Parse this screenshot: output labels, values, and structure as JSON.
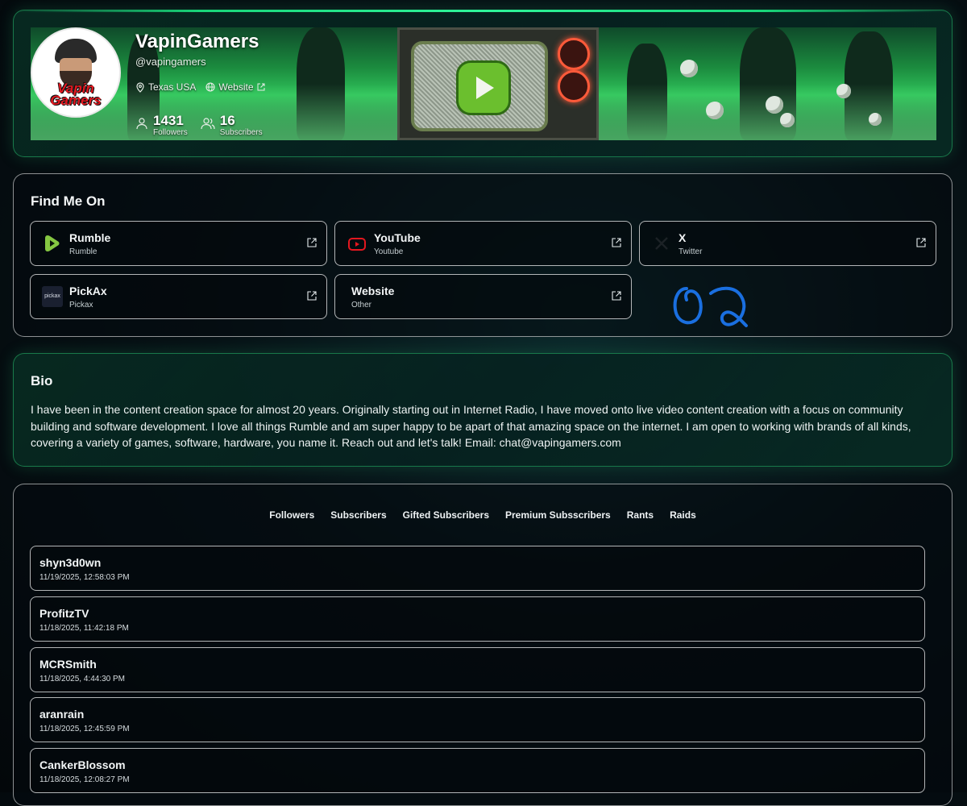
{
  "profile": {
    "name": "VapinGamers",
    "handle": "@vapingamers",
    "avatar_text": "Vapin Gamers",
    "location": "Texas USA",
    "website_label": "Website",
    "followers_count": "1431",
    "followers_label": "Followers",
    "subscribers_count": "16",
    "subscribers_label": "Subscribers"
  },
  "find_me_on": {
    "title": "Find Me On",
    "links": [
      {
        "name": "Rumble",
        "type": "Rumble",
        "icon": "rumble-icon"
      },
      {
        "name": "YouTube",
        "type": "Youtube",
        "icon": "youtube-icon"
      },
      {
        "name": "X",
        "type": "Twitter",
        "icon": "x-icon"
      },
      {
        "name": "PickAx",
        "type": "Pickax",
        "icon": "pickax-icon",
        "logo_text": "pickax"
      },
      {
        "name": "Website",
        "type": "Other",
        "icon": "globe-icon"
      }
    ]
  },
  "bio": {
    "title": "Bio",
    "text": "I have been in the content creation space for almost 20 years. Originally starting out in Internet Radio, I have moved onto live video content creation with a focus on community building and software development. I love all things Rumble and am super happy to be apart of that amazing space on the internet. I am open to working with brands of all kinds, covering a variety of games, software, hardware, you name it. Reach out and let's talk! Email: chat@vapingamers.com"
  },
  "tabs": [
    "Followers",
    "Subscribers",
    "Gifted Subscribers",
    "Premium Subsscribers",
    "Rants",
    "Raids"
  ],
  "followers": [
    {
      "user": "shyn3d0wn",
      "date": "11/19/2025, 12:58:03 PM"
    },
    {
      "user": "ProfitzTV",
      "date": "11/18/2025, 11:42:18 PM"
    },
    {
      "user": "MCRSmith",
      "date": "11/18/2025, 4:44:30 PM"
    },
    {
      "user": "aranrain",
      "date": "11/18/2025, 12:45:59 PM"
    },
    {
      "user": "CankerBlossom",
      "date": "11/18/2025, 12:08:27 PM"
    }
  ],
  "colors": {
    "accent": "#19d67a",
    "rumble": "#85c742",
    "youtube": "#e3171f",
    "annotation": "#1a6fe0"
  }
}
